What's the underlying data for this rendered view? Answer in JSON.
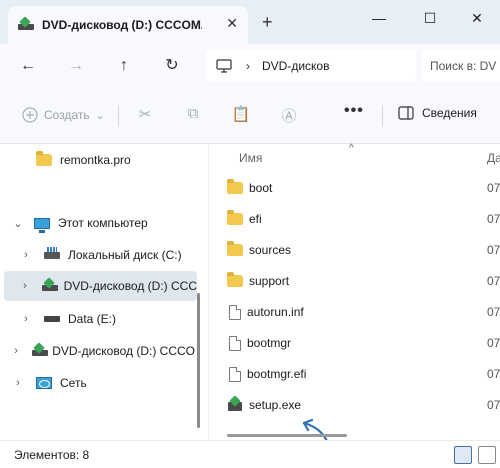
{
  "window": {
    "tab_title": "DVD-дисковод (D:) CCCOMA_",
    "tab_close": "✕",
    "new_tab": "+",
    "min": "—",
    "max": "☐",
    "close": "✕"
  },
  "nav": {
    "back": "←",
    "forward": "→",
    "up": "↑",
    "refresh": "↻",
    "separator": "›",
    "address": "DVD-дисков",
    "search_placeholder": "Поиск в: DV"
  },
  "commands": {
    "create": "Создать",
    "create_caret": "⌄",
    "more": "•••",
    "details": "Сведения"
  },
  "sidebar": {
    "items": [
      {
        "label": "remontka.pro",
        "chevron": "",
        "icon": "folder-icon"
      },
      {
        "label": "Этот компьютер",
        "chevron": "⌄",
        "icon": "computer-icon"
      },
      {
        "label": "Локальный диск (C:)",
        "chevron": "›",
        "icon": "local-disk-icon"
      },
      {
        "label": "DVD-дисковод (D:) CCC",
        "chevron": "›",
        "icon": "dvd-drive-icon"
      },
      {
        "label": "Data (E:)",
        "chevron": "›",
        "icon": "drive-icon"
      },
      {
        "label": "DVD-дисковод (D:) CCCO",
        "chevron": "›",
        "icon": "dvd-drive-icon"
      },
      {
        "label": "Сеть",
        "chevron": "›",
        "icon": "network-icon"
      }
    ]
  },
  "content": {
    "column_name": "Имя",
    "column_date": "Да",
    "sort_caret": "^",
    "files": [
      {
        "name": "boot",
        "date": "07",
        "icon": "folder-icon"
      },
      {
        "name": "efi",
        "date": "07",
        "icon": "folder-icon"
      },
      {
        "name": "sources",
        "date": "07",
        "icon": "folder-icon"
      },
      {
        "name": "support",
        "date": "07",
        "icon": "folder-icon"
      },
      {
        "name": "autorun.inf",
        "date": "07",
        "icon": "settings-file-icon"
      },
      {
        "name": "bootmgr",
        "date": "07",
        "icon": "file-icon"
      },
      {
        "name": "bootmgr.efi",
        "date": "07",
        "icon": "file-icon"
      },
      {
        "name": "setup.exe",
        "date": "07",
        "icon": "setup-icon"
      }
    ]
  },
  "status": {
    "items_count": "Элементов: 8"
  },
  "colors": {
    "title_bg": "#e8eef5",
    "selected_bg": "#dfe6ee",
    "folder": "#f2c94c",
    "arrow": "#2f6fb5"
  }
}
